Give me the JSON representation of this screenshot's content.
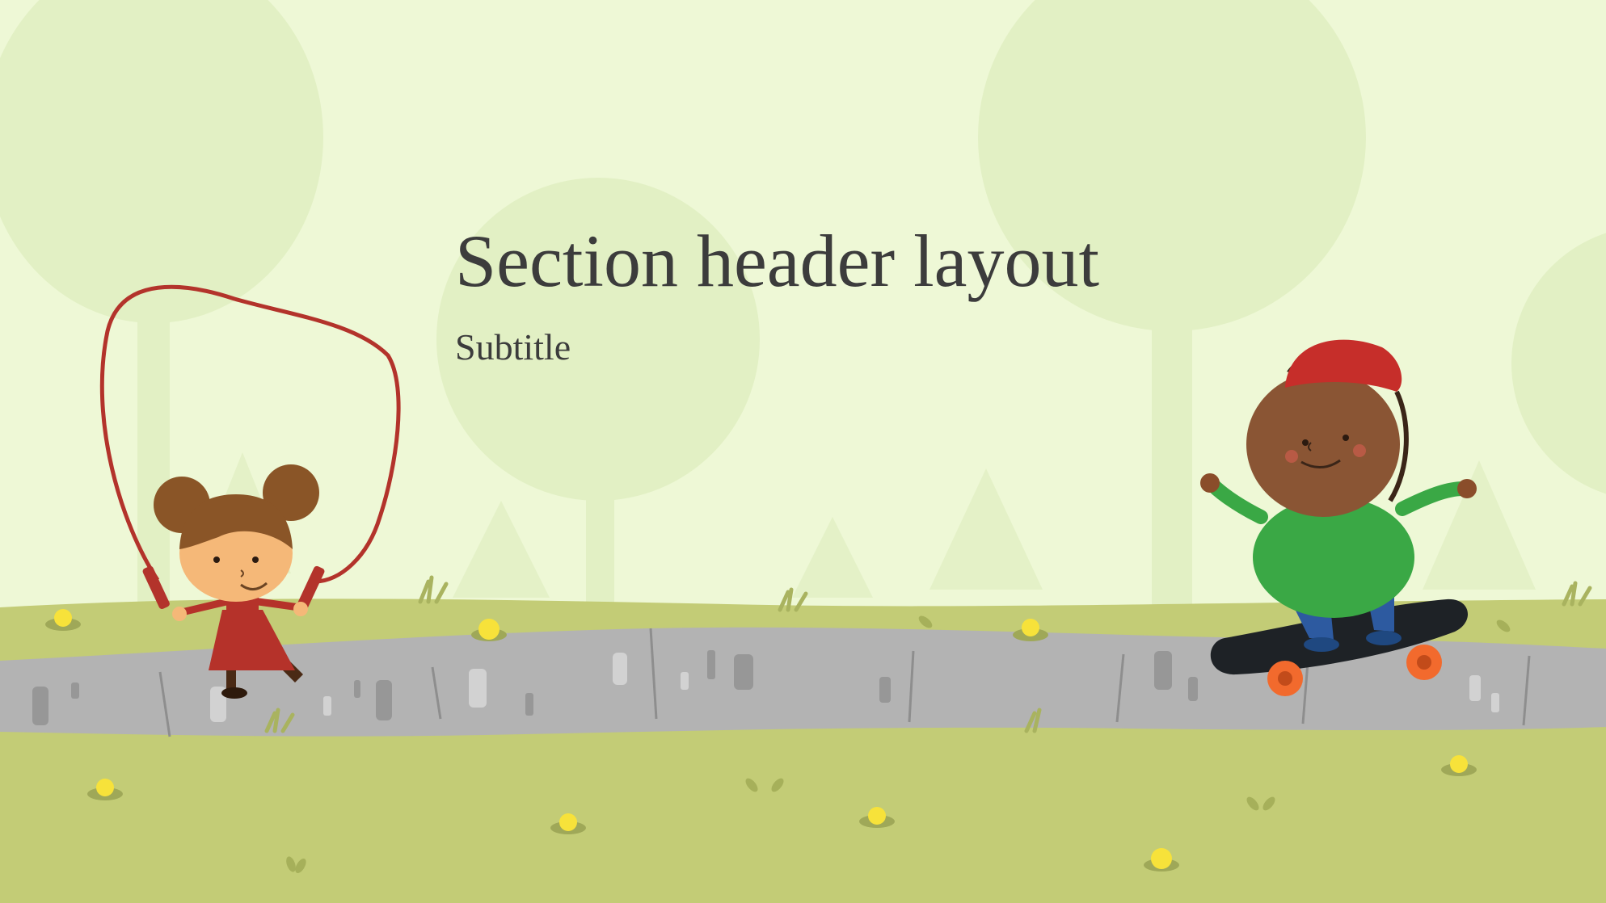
{
  "slide": {
    "title": "Section header layout",
    "subtitle": "Subtitle"
  },
  "palette": {
    "sky": "#eef8d6",
    "tree_shadow": "#dfefc0",
    "grass": "#c3cc76",
    "path": "#b3b3b3",
    "text": "#3c3c3c"
  },
  "icons": [
    "jump-rope-girl-illustration",
    "skateboard-boy-illustration",
    "tree-silhouette-icon",
    "flower-icon"
  ]
}
